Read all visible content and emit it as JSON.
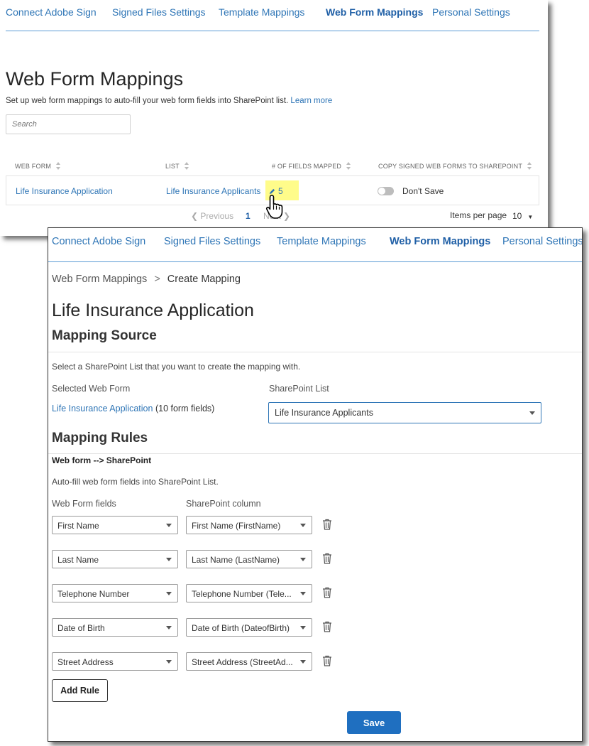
{
  "colors": {
    "accent": "#2e75b6",
    "highlight": "#fffc8a",
    "primary_button": "#1f6fc0"
  },
  "panel1": {
    "nav": [
      "Connect Adobe Sign",
      "Signed Files Settings",
      "Template Mappings",
      "Web Form Mappings",
      "Personal Settings"
    ],
    "active_tab": "Web Form Mappings",
    "title": "Web Form Mappings",
    "description": "Set up web form mappings to auto-fill your web form fields into SharePoint list.",
    "learn_more": "Learn more",
    "search_placeholder": "Search",
    "columns": [
      "WEB FORM",
      "LIST",
      "# OF FIELDS MAPPED",
      "COPY SIGNED WEB FORMS TO SHAREPOINT"
    ],
    "row": {
      "web_form": "Life Insurance Application",
      "list": "Life Insurance Applicants",
      "fields_mapped": "5",
      "copy_setting": "Don't Save"
    },
    "pagination": {
      "previous": "Previous",
      "page": "1",
      "next": "Next"
    },
    "items_per_page_label": "Items per page",
    "items_per_page_value": "10"
  },
  "panel2": {
    "nav": [
      "Connect Adobe Sign",
      "Signed Files Settings",
      "Template Mappings",
      "Web Form Mappings",
      "Personal Settings"
    ],
    "active_tab": "Web Form Mappings",
    "breadcrumb": {
      "parent": "Web Form Mappings",
      "separator": ">",
      "current": "Create Mapping"
    },
    "title": "Life Insurance Application",
    "mapping_source": {
      "heading": "Mapping Source",
      "instruction": "Select a SharePoint List that you want to create the mapping with.",
      "selected_web_form_label": "Selected Web Form",
      "selected_web_form": "Life Insurance Application",
      "selected_web_form_count": "(10 form fields)",
      "sharepoint_list_label": "SharePoint List",
      "sharepoint_list_value": "Life Insurance Applicants"
    },
    "mapping_rules": {
      "heading": "Mapping Rules",
      "direction": "Web form --> SharePoint",
      "description": "Auto-fill web form fields into SharePoint List.",
      "col_web_form": "Web Form fields",
      "col_sharepoint": "SharePoint column",
      "rules": [
        {
          "web_form_field": "First Name",
          "sharepoint_column": "First Name (FirstName)"
        },
        {
          "web_form_field": "Last Name",
          "sharepoint_column": "Last Name (LastName)"
        },
        {
          "web_form_field": "Telephone Number",
          "sharepoint_column": "Telephone Number (Tele..."
        },
        {
          "web_form_field": "Date of Birth",
          "sharepoint_column": "Date of Birth (DateofBirth)"
        },
        {
          "web_form_field": "Street Address",
          "sharepoint_column": "Street Address (StreetAd..."
        }
      ],
      "add_rule": "Add Rule"
    },
    "save": "Save"
  }
}
